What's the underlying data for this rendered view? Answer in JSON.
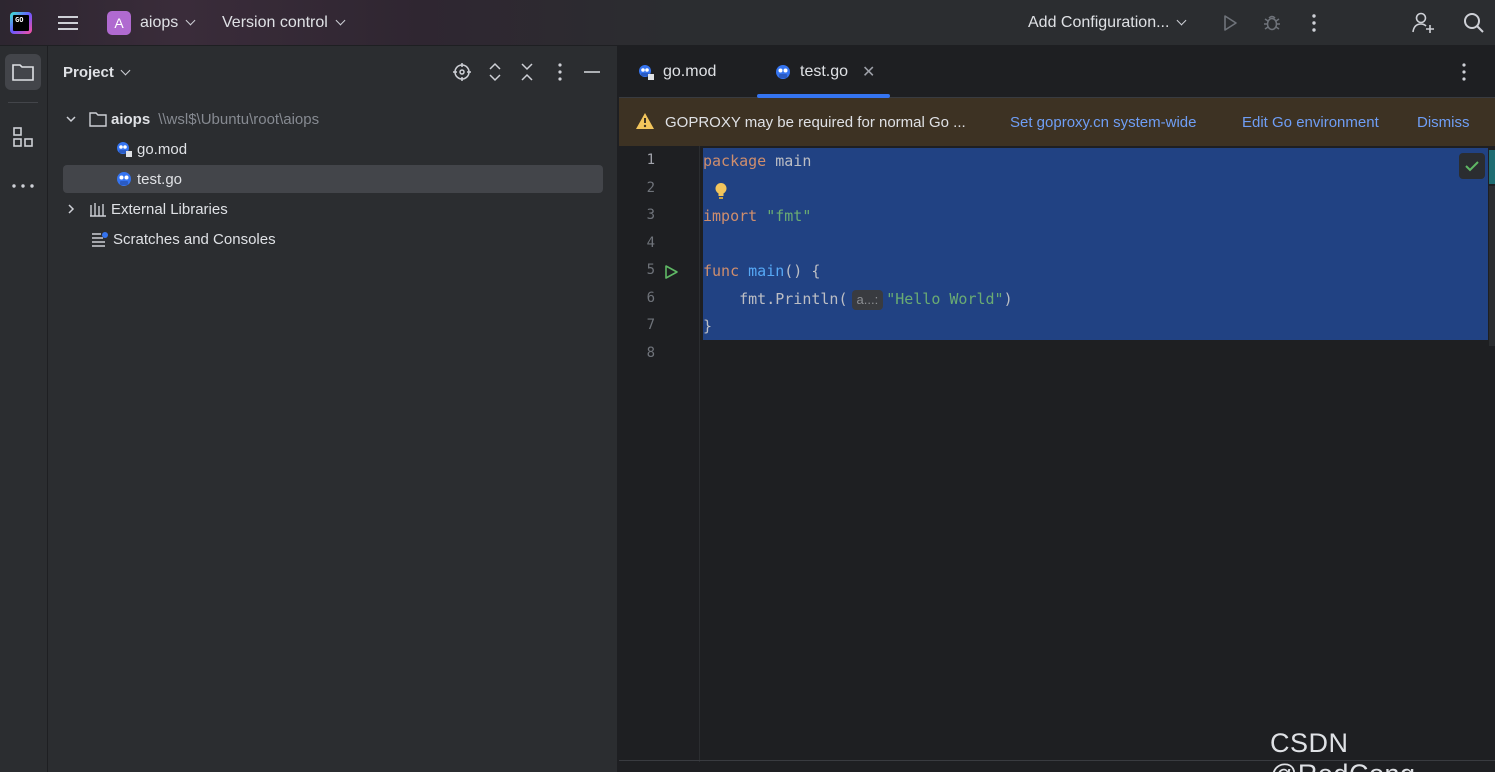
{
  "titlebar": {
    "project_initial": "A",
    "project_name": "aiops",
    "version_control": "Version control",
    "add_configuration": "Add Configuration..."
  },
  "project_panel": {
    "title": "Project",
    "tree": [
      {
        "label": "aiops",
        "path": "\\\\wsl$\\Ubuntu\\root\\aiops",
        "expanded": true
      },
      {
        "label": "go.mod"
      },
      {
        "label": "test.go",
        "selected": true
      },
      {
        "label": "External Libraries",
        "expanded": false
      },
      {
        "label": "Scratches and Consoles"
      }
    ]
  },
  "editor": {
    "tabs": [
      {
        "label": "go.mod",
        "active": false
      },
      {
        "label": "test.go",
        "active": true
      }
    ],
    "banner": {
      "message": "GOPROXY may be required for normal Go ...",
      "link1": "Set goproxy.cn system-wide",
      "link2": "Edit Go environment",
      "link3": "Dismiss"
    },
    "line_numbers": [
      "1",
      "2",
      "3",
      "4",
      "5",
      "6",
      "7",
      "8"
    ],
    "code": {
      "l1_kw": "package",
      "l1_name": " main",
      "l3_kw": "import",
      "l3_str": " \"fmt\"",
      "l5_kw": "func",
      "l5_fn": " main",
      "l5_rest": "() {",
      "l6_indent": "    ",
      "l6_pkg": "fmt",
      "l6_call": ".Println(",
      "l6_hint": "a...:",
      "l6_str": "\"Hello World\"",
      "l6_end": ")",
      "l7": "}"
    }
  },
  "watermark": "CSDN @RedCong",
  "colors": {
    "accent": "#3574f0",
    "selection": "#214283",
    "keyword": "#cf8e6d",
    "function": "#56a8f5",
    "string": "#6aab73",
    "warning_banner": "#3d3223"
  }
}
